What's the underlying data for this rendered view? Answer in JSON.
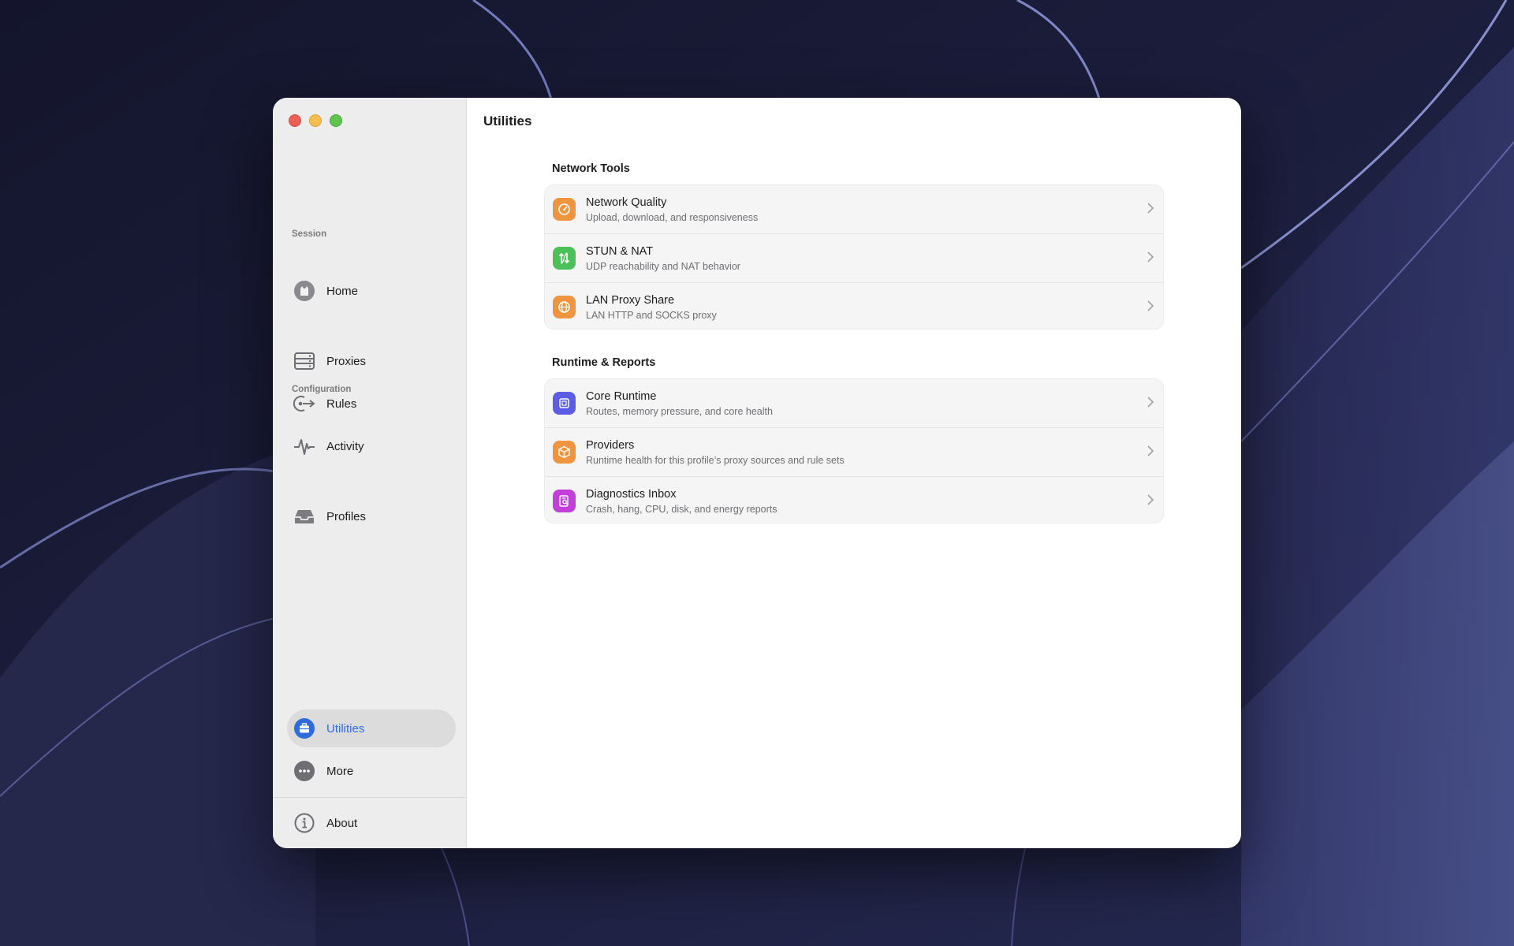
{
  "window": {
    "title": "Utilities"
  },
  "sidebar": {
    "home": {
      "label": "Home",
      "icon": "home-avatar-icon"
    },
    "session_label": "Session",
    "session_items": [
      {
        "label": "Proxies",
        "icon": "server-stack-icon"
      },
      {
        "label": "Rules",
        "icon": "route-arrow-icon"
      },
      {
        "label": "Activity",
        "icon": "waveform-icon"
      }
    ],
    "configuration_label": "Configuration",
    "configuration_items": [
      {
        "label": "Profiles",
        "icon": "tray-icon"
      }
    ],
    "bottom_items": [
      {
        "label": "Utilities",
        "icon": "toolbox-icon",
        "active": true
      },
      {
        "label": "More",
        "icon": "ellipsis-circle-icon",
        "active": false
      }
    ],
    "about": {
      "label": "About",
      "icon": "info-circle-icon"
    }
  },
  "groups": [
    {
      "title": "Network Tools",
      "items": [
        {
          "title": "Network Quality",
          "subtitle": "Upload, download, and responsiveness",
          "icon": "speedometer-icon",
          "color": "#f0953f"
        },
        {
          "title": "STUN & NAT",
          "subtitle": "UDP reachability and NAT behavior",
          "icon": "arrows-up-down-icon",
          "color": "#4cc15a"
        },
        {
          "title": "LAN Proxy Share",
          "subtitle": "LAN HTTP and SOCKS proxy",
          "icon": "globe-network-icon",
          "color": "#f0953f"
        }
      ]
    },
    {
      "title": "Runtime & Reports",
      "items": [
        {
          "title": "Core Runtime",
          "subtitle": "Routes, memory pressure, and core health",
          "icon": "cpu-chip-icon",
          "color": "#5d5ce6"
        },
        {
          "title": "Providers",
          "subtitle": "Runtime health for this profile’s proxy sources and rule sets",
          "icon": "package-cube-icon",
          "color": "#f0953f"
        },
        {
          "title": "Diagnostics Inbox",
          "subtitle": "Crash, hang, CPU, disk, and energy reports",
          "icon": "report-search-icon",
          "color": "#c23fd9"
        }
      ]
    }
  ],
  "colors": {
    "accent": "#2f6bd9",
    "sidebar_bg": "#ededed"
  }
}
